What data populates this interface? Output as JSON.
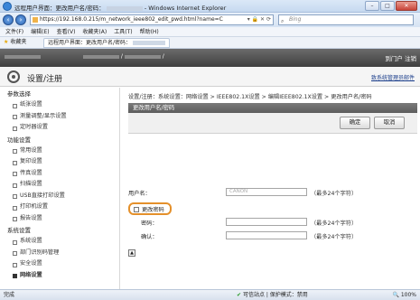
{
  "window": {
    "title": "远程用户界面：更改用户名/密码：",
    "title_suffix": "- Windows Internet Explorer",
    "buttons": [
      "–",
      "□",
      "✕"
    ]
  },
  "address_bar": {
    "url": "https://192.168.0.215/m_network_ieee802_edit_pwd.html?name=C",
    "search_placeholder": "Bing"
  },
  "menu": [
    "文件(F)",
    "编辑(E)",
    "查看(V)",
    "收藏夹(A)",
    "工具(T)",
    "帮助(H)"
  ],
  "favorites": {
    "label": "收藏夹",
    "tab_title": "远程用户界面：更改用户名/密码："
  },
  "top_band": {
    "portal_link": "到门户 注销"
  },
  "header": {
    "title": "设置/注册",
    "sysmail": "致系统管理员邮件"
  },
  "sidebar": {
    "sections": [
      {
        "label": "参数选择",
        "items": [
          "纸张设置",
          "测量调整/显示设置",
          "定时器设置"
        ]
      },
      {
        "label": "功能设置",
        "items": [
          "常用设置",
          "复印设置",
          "传真设置",
          "扫描设置",
          "USB直接打印设置",
          "打印机设置",
          "报告设置"
        ]
      },
      {
        "label": "系统设置",
        "items": [
          "系统设置",
          "部门识别码管理",
          "安全设置",
          "网络设置"
        ]
      }
    ],
    "active_item": "网络设置"
  },
  "main": {
    "breadcrumb": "设置/注册：系统设置：网络设置 > IEEE802.1X设置 > 编辑IEEE802.1X设置 > 更改用户名/密码",
    "panel_title": "更改用户名/密码",
    "ok_button": "确定",
    "cancel_button": "取消",
    "username_label": "用户名：",
    "username_value": "CANON",
    "username_hint": "（最多24个字符）",
    "change_password_label": "更改密码",
    "password_label": "密码：",
    "password_hint": "（最多24个字符）",
    "confirm_label": "确认：",
    "confirm_hint": "（最多24个字符）"
  },
  "status_bar": {
    "done": "完成",
    "zone": "可信站点 | 保护模式：禁用",
    "zoom": "100%"
  }
}
